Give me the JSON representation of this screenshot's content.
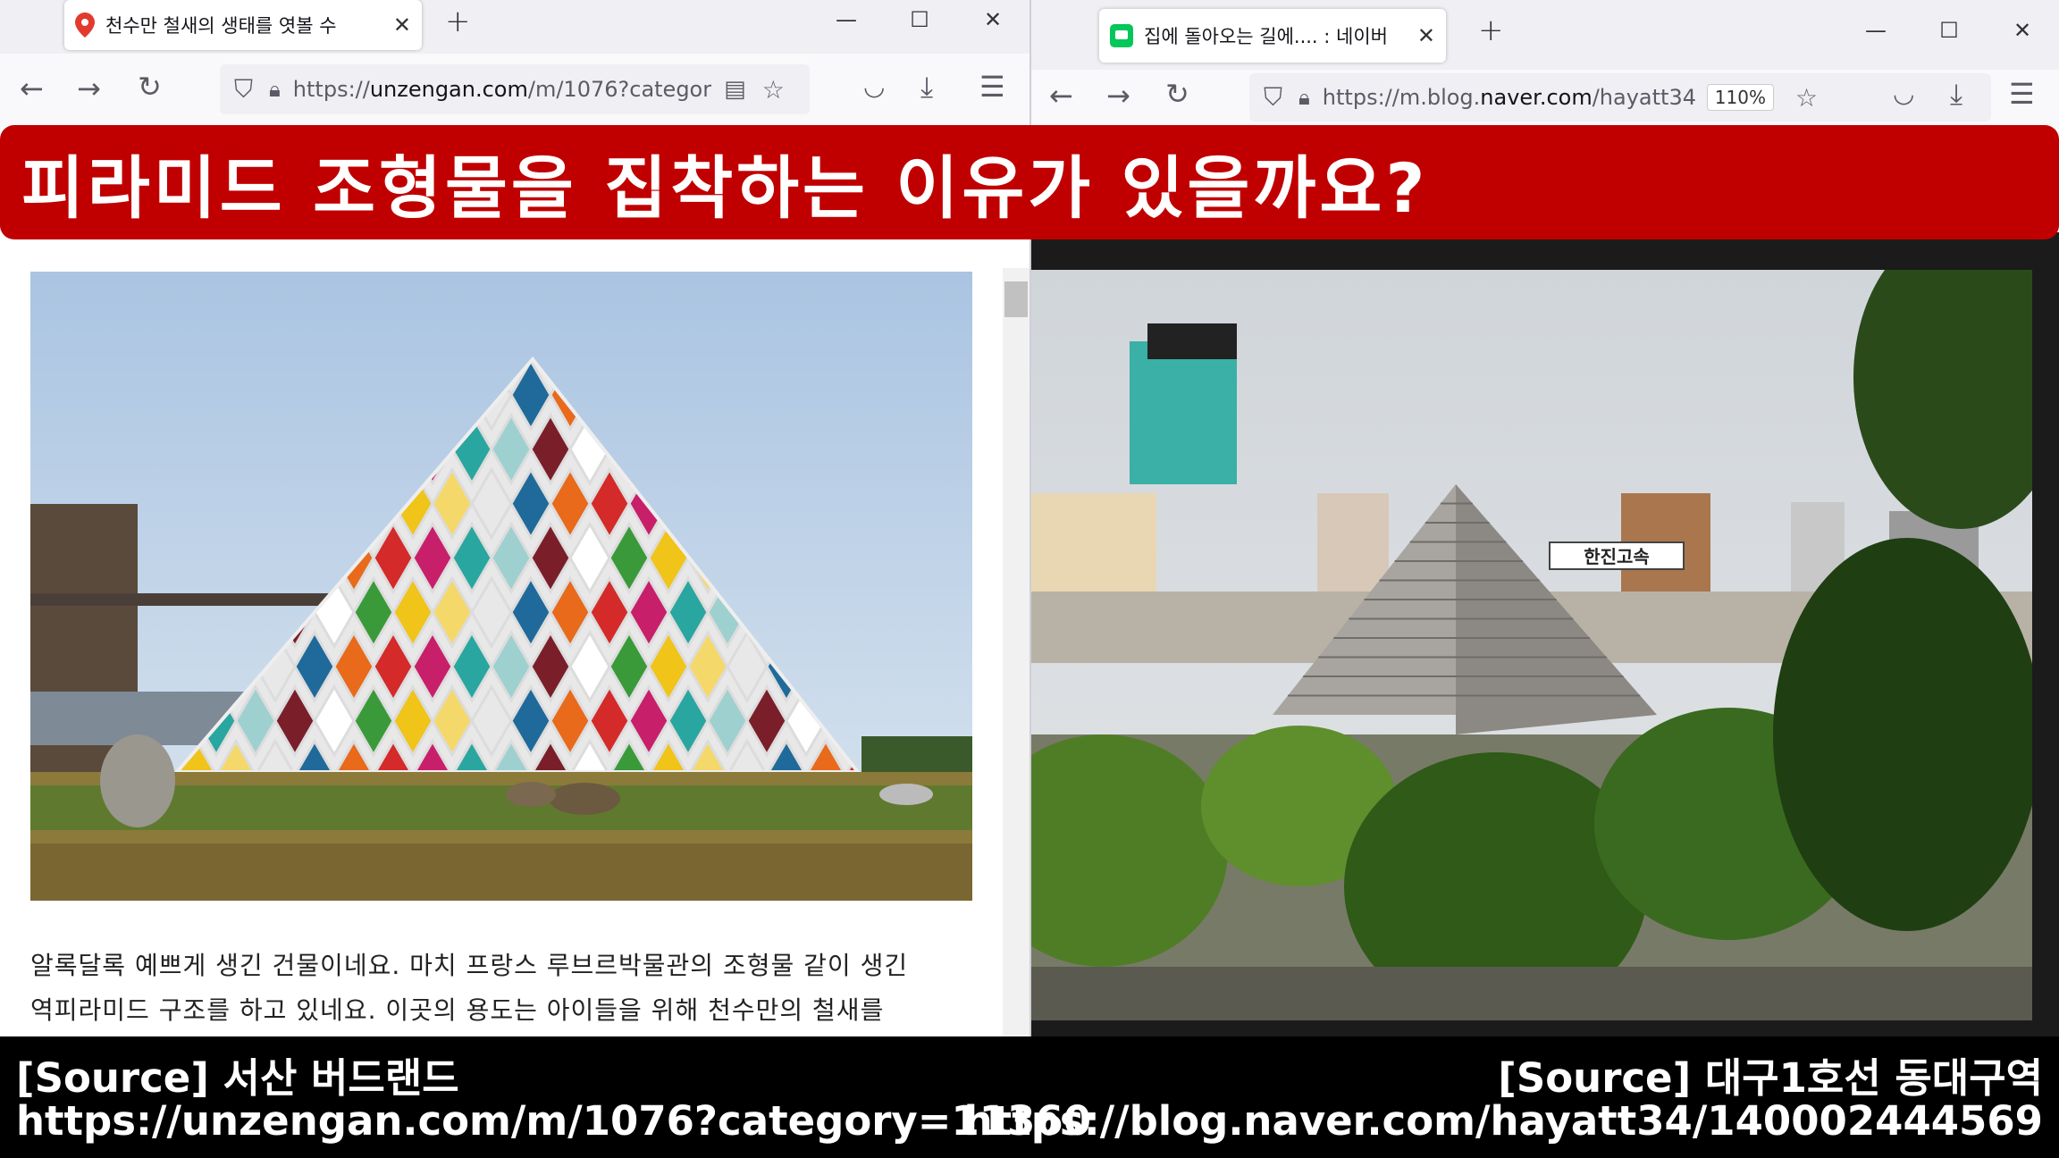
{
  "left_window": {
    "tab_title": "천수만 철새의 생태를 엿볼 수",
    "url_prefix": "https://",
    "url_host": "unzengan.com",
    "url_path": "/m/1076?categor",
    "article_line1": "알록달록 예쁘게 생긴 건물이네요. 마치 프랑스 루브르박물관의 조형물 같이 생긴",
    "article_line2": "역피라미드 구조를 하고 있네요. 이곳의 용도는 아이들을 위해 천수만의 철새를"
  },
  "right_window": {
    "tab_title": "집에 돌아오는 길에.... : 네이버",
    "url_prefix": "https://m.blog.",
    "url_host": "naver.com",
    "url_path": "/hayatt34",
    "zoom": "110%",
    "sign_text": "한진고속"
  },
  "banner": {
    "title": "피라미드 조형물을 집착하는 이유가 있을까요?"
  },
  "footer": {
    "left_source": "[Source] 서산 버드랜드",
    "left_url": "https://unzengan.com/m/1076?category=11360",
    "right_source": "[Source] 대구1호선 동대구역",
    "right_url": "https://blog.naver.com/hayatt34/140002444569"
  },
  "window_controls": {
    "minimize": "—",
    "maximize": "☐",
    "close": "✕"
  },
  "icons": [
    "map-pin-icon",
    "close-icon",
    "plus-icon",
    "back-icon",
    "forward-icon",
    "reload-icon",
    "shield-icon",
    "lock-icon",
    "reader-icon",
    "star-icon",
    "pocket-icon",
    "download-icon",
    "menu-icon",
    "naver-blog-icon"
  ],
  "colors": {
    "banner_red": "#c00000",
    "footer_black": "#000000",
    "naver_green": "#03c75a"
  }
}
